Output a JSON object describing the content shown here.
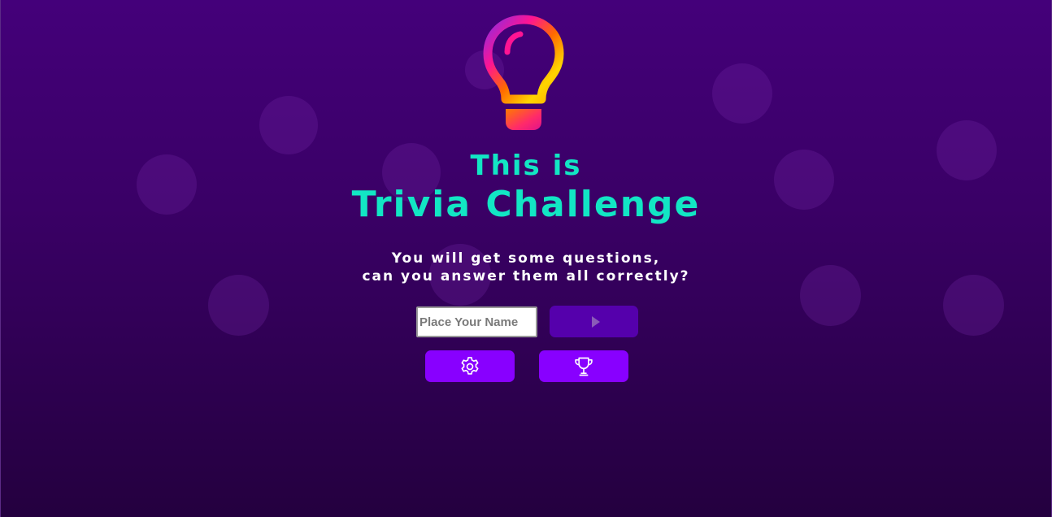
{
  "header": {
    "logo_icon": "lightbulb-icon",
    "subtitle": "This is",
    "title": "Trivia Challenge"
  },
  "description": {
    "line1": "You will get some questions,",
    "line2": "can you answer them all correctly?"
  },
  "form": {
    "name_placeholder": "Place Your Name",
    "name_value": "",
    "play_icon": "play-icon"
  },
  "actions": {
    "settings_icon": "gear-icon",
    "ranking_icon": "trophy-icon"
  },
  "colors": {
    "background_top": "#44007a",
    "background_bottom": "#24003f",
    "title": "#12e6c4",
    "play_button": "#5500ac",
    "action_button": "#8800ff"
  }
}
